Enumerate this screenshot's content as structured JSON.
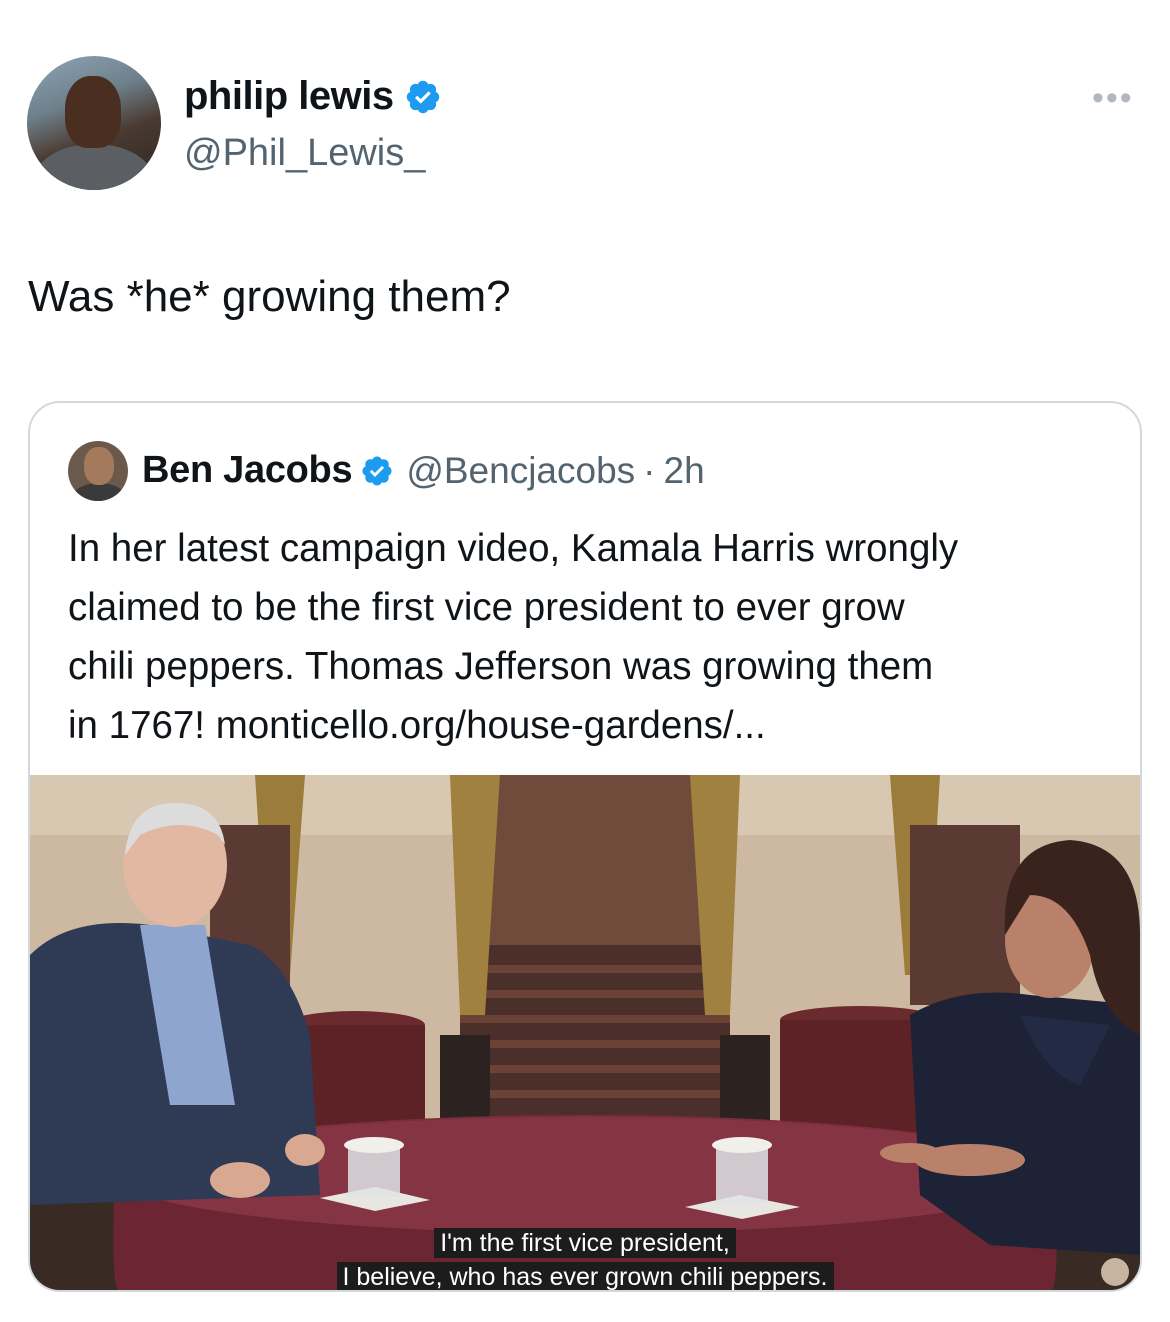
{
  "author": {
    "name": "philip lewis",
    "handle": "@Phil_Lewis_"
  },
  "more_label": "•••",
  "tweet_text": "Was *he* growing them?",
  "quoted": {
    "name": "Ben Jacobs",
    "handle": "@Bencjacobs",
    "separator": "·",
    "time": "2h",
    "text_lines": [
      "In her latest campaign video, Kamala Harris wrongly",
      "claimed to be the first vice president to ever grow",
      "chili peppers. Thomas Jefferson was growing them",
      "in 1767! monticello.org/house-gardens/..."
    ],
    "media": {
      "subtitle_lines": [
        "I'm the first vice president,",
        "I believe, who has ever grown chili peppers."
      ]
    }
  },
  "colors": {
    "verified": "#1d9bf0",
    "secondary_text": "#536471",
    "border": "#cfd9de"
  }
}
